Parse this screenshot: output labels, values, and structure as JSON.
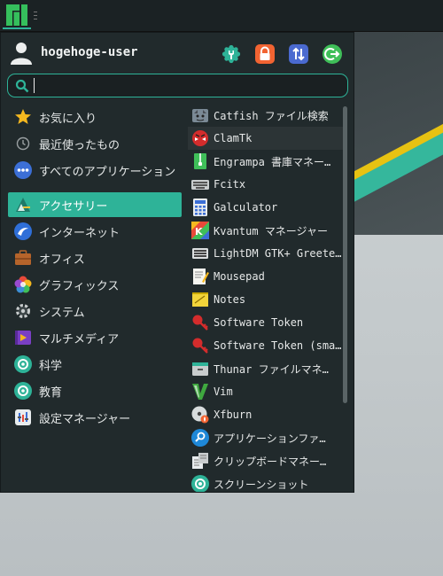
{
  "panel": {
    "menu_icon": "manjaro-logo-icon"
  },
  "user": {
    "name": "hogehoge-user"
  },
  "actions": [
    {
      "name": "settings-icon",
      "color": "#2eb398"
    },
    {
      "name": "lock-icon",
      "color": "#f26432"
    },
    {
      "name": "switch-user-icon",
      "color": "#4a6ad0"
    },
    {
      "name": "logout-icon",
      "color": "#3fbf59"
    }
  ],
  "search": {
    "value": "",
    "placeholder": ""
  },
  "categories": [
    {
      "label": "お気に入り",
      "icon": "star-icon"
    },
    {
      "label": "最近使ったもの",
      "icon": "clock-icon"
    },
    {
      "label": "すべてのアプリケーション",
      "icon": "all-apps-icon"
    },
    {
      "label": "アクセサリー",
      "icon": "accessories-icon",
      "active": true
    },
    {
      "label": "インターネット",
      "icon": "internet-icon"
    },
    {
      "label": "オフィス",
      "icon": "office-icon"
    },
    {
      "label": "グラフィックス",
      "icon": "graphics-icon"
    },
    {
      "label": "システム",
      "icon": "system-icon"
    },
    {
      "label": "マルチメディア",
      "icon": "multimedia-icon"
    },
    {
      "label": "科学",
      "icon": "science-icon"
    },
    {
      "label": "教育",
      "icon": "education-icon"
    },
    {
      "label": "設定マネージャー",
      "icon": "settings-manager-icon"
    }
  ],
  "apps": [
    {
      "label": "Catfish ファイル検索",
      "icon": "catfish-icon"
    },
    {
      "label": "ClamTk",
      "icon": "clamtk-icon",
      "hover": true
    },
    {
      "label": "Engrampa 書庫マネー…",
      "icon": "archive-icon"
    },
    {
      "label": "Fcitx",
      "icon": "keyboard-icon"
    },
    {
      "label": "Galculator",
      "icon": "calculator-icon"
    },
    {
      "label": "Kvantum マネージャー",
      "icon": "kvantum-icon"
    },
    {
      "label": "LightDM GTK+ Greete…",
      "icon": "lightdm-icon"
    },
    {
      "label": "Mousepad",
      "icon": "mousepad-icon"
    },
    {
      "label": "Notes",
      "icon": "notes-icon"
    },
    {
      "label": "Software Token",
      "icon": "token-icon"
    },
    {
      "label": "Software Token (sma…",
      "icon": "token-icon"
    },
    {
      "label": "Thunar ファイルマネ…",
      "icon": "thunar-icon"
    },
    {
      "label": "Vim",
      "icon": "vim-icon"
    },
    {
      "label": "Xfburn",
      "icon": "xfburn-icon"
    },
    {
      "label": "アプリケーションファ…",
      "icon": "app-finder-icon"
    },
    {
      "label": "クリップボードマネー…",
      "icon": "clipboard-icon"
    },
    {
      "label": "スクリーンショット",
      "icon": "screenshot-icon"
    }
  ]
}
